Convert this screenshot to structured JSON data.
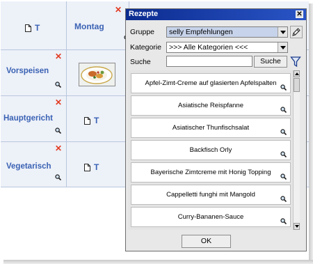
{
  "planner": {
    "day_header": "Montag",
    "rows": [
      {
        "label": "Vorspeisen"
      },
      {
        "label": "Hauptgericht"
      },
      {
        "label": "Vegetarisch"
      }
    ],
    "t_letter": "T",
    "remove_mark": "✕",
    "accent_color": "#3a62b4",
    "remove_color": "#e23a20"
  },
  "dialog": {
    "title": "Rezepte",
    "close_glyph": "✕",
    "group_label": "Gruppe",
    "group_value": "selly Empfehlungen",
    "category_label": "Kategorie",
    "category_value": ">>> Alle Kategorien <<<",
    "search_label": "Suche",
    "search_value": "",
    "search_button": "Suche",
    "ok_button": "OK",
    "recipes": [
      "Apfel-Zimt-Creme auf glasierten Apfelspalten",
      "Asiatische Reispfanne",
      "Asiatischer Thunfischsalat",
      "Backfisch Orly",
      "Bayerische Zimtcreme mit Honig Topping",
      "Cappelletti funghi mit Mangold",
      "Curry-Bananen-Sauce"
    ],
    "titlebar_color": "#0b2b8f"
  }
}
